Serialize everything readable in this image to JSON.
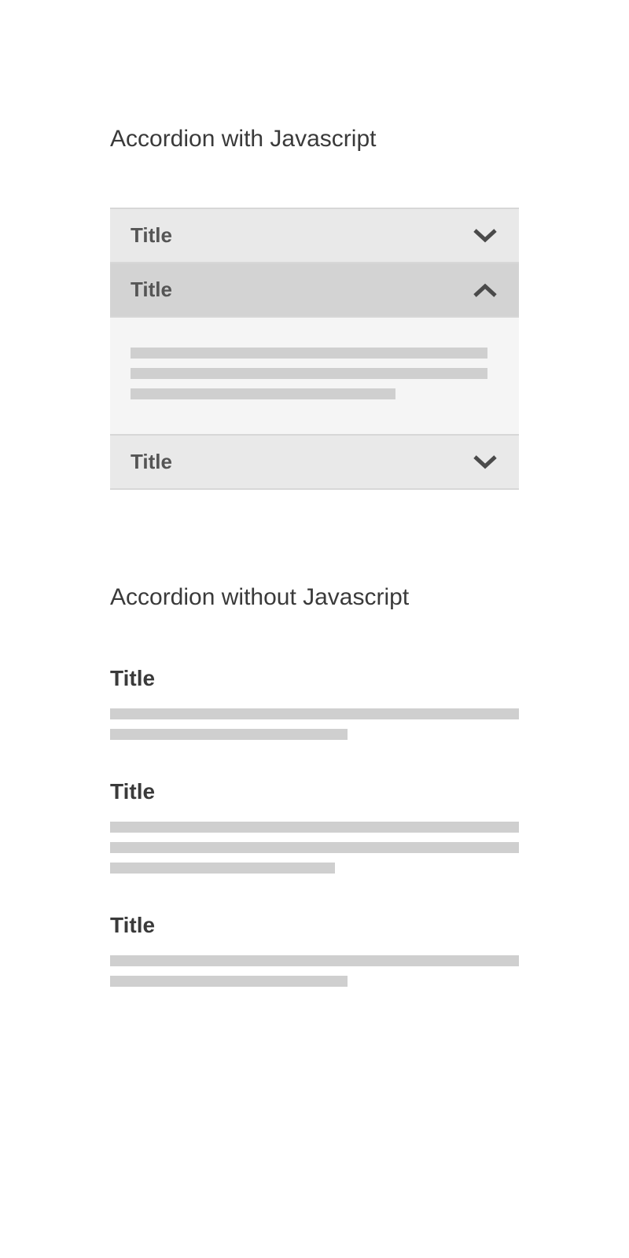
{
  "section_js": {
    "heading": "Accordion with Javascript",
    "panels": [
      {
        "title": "Title",
        "open": false,
        "icon": "chevron-down",
        "content_lines": []
      },
      {
        "title": "Title",
        "open": true,
        "icon": "chevron-up",
        "content_lines": [
          97,
          97,
          72
        ]
      },
      {
        "title": "Title",
        "open": false,
        "icon": "chevron-down",
        "content_lines": []
      }
    ]
  },
  "section_nojs": {
    "heading": "Accordion without Javascript",
    "items": [
      {
        "title": "Title",
        "content_lines": [
          100,
          58
        ]
      },
      {
        "title": "Title",
        "content_lines": [
          100,
          100,
          55
        ]
      },
      {
        "title": "Title",
        "content_lines": [
          100,
          58
        ]
      }
    ]
  }
}
